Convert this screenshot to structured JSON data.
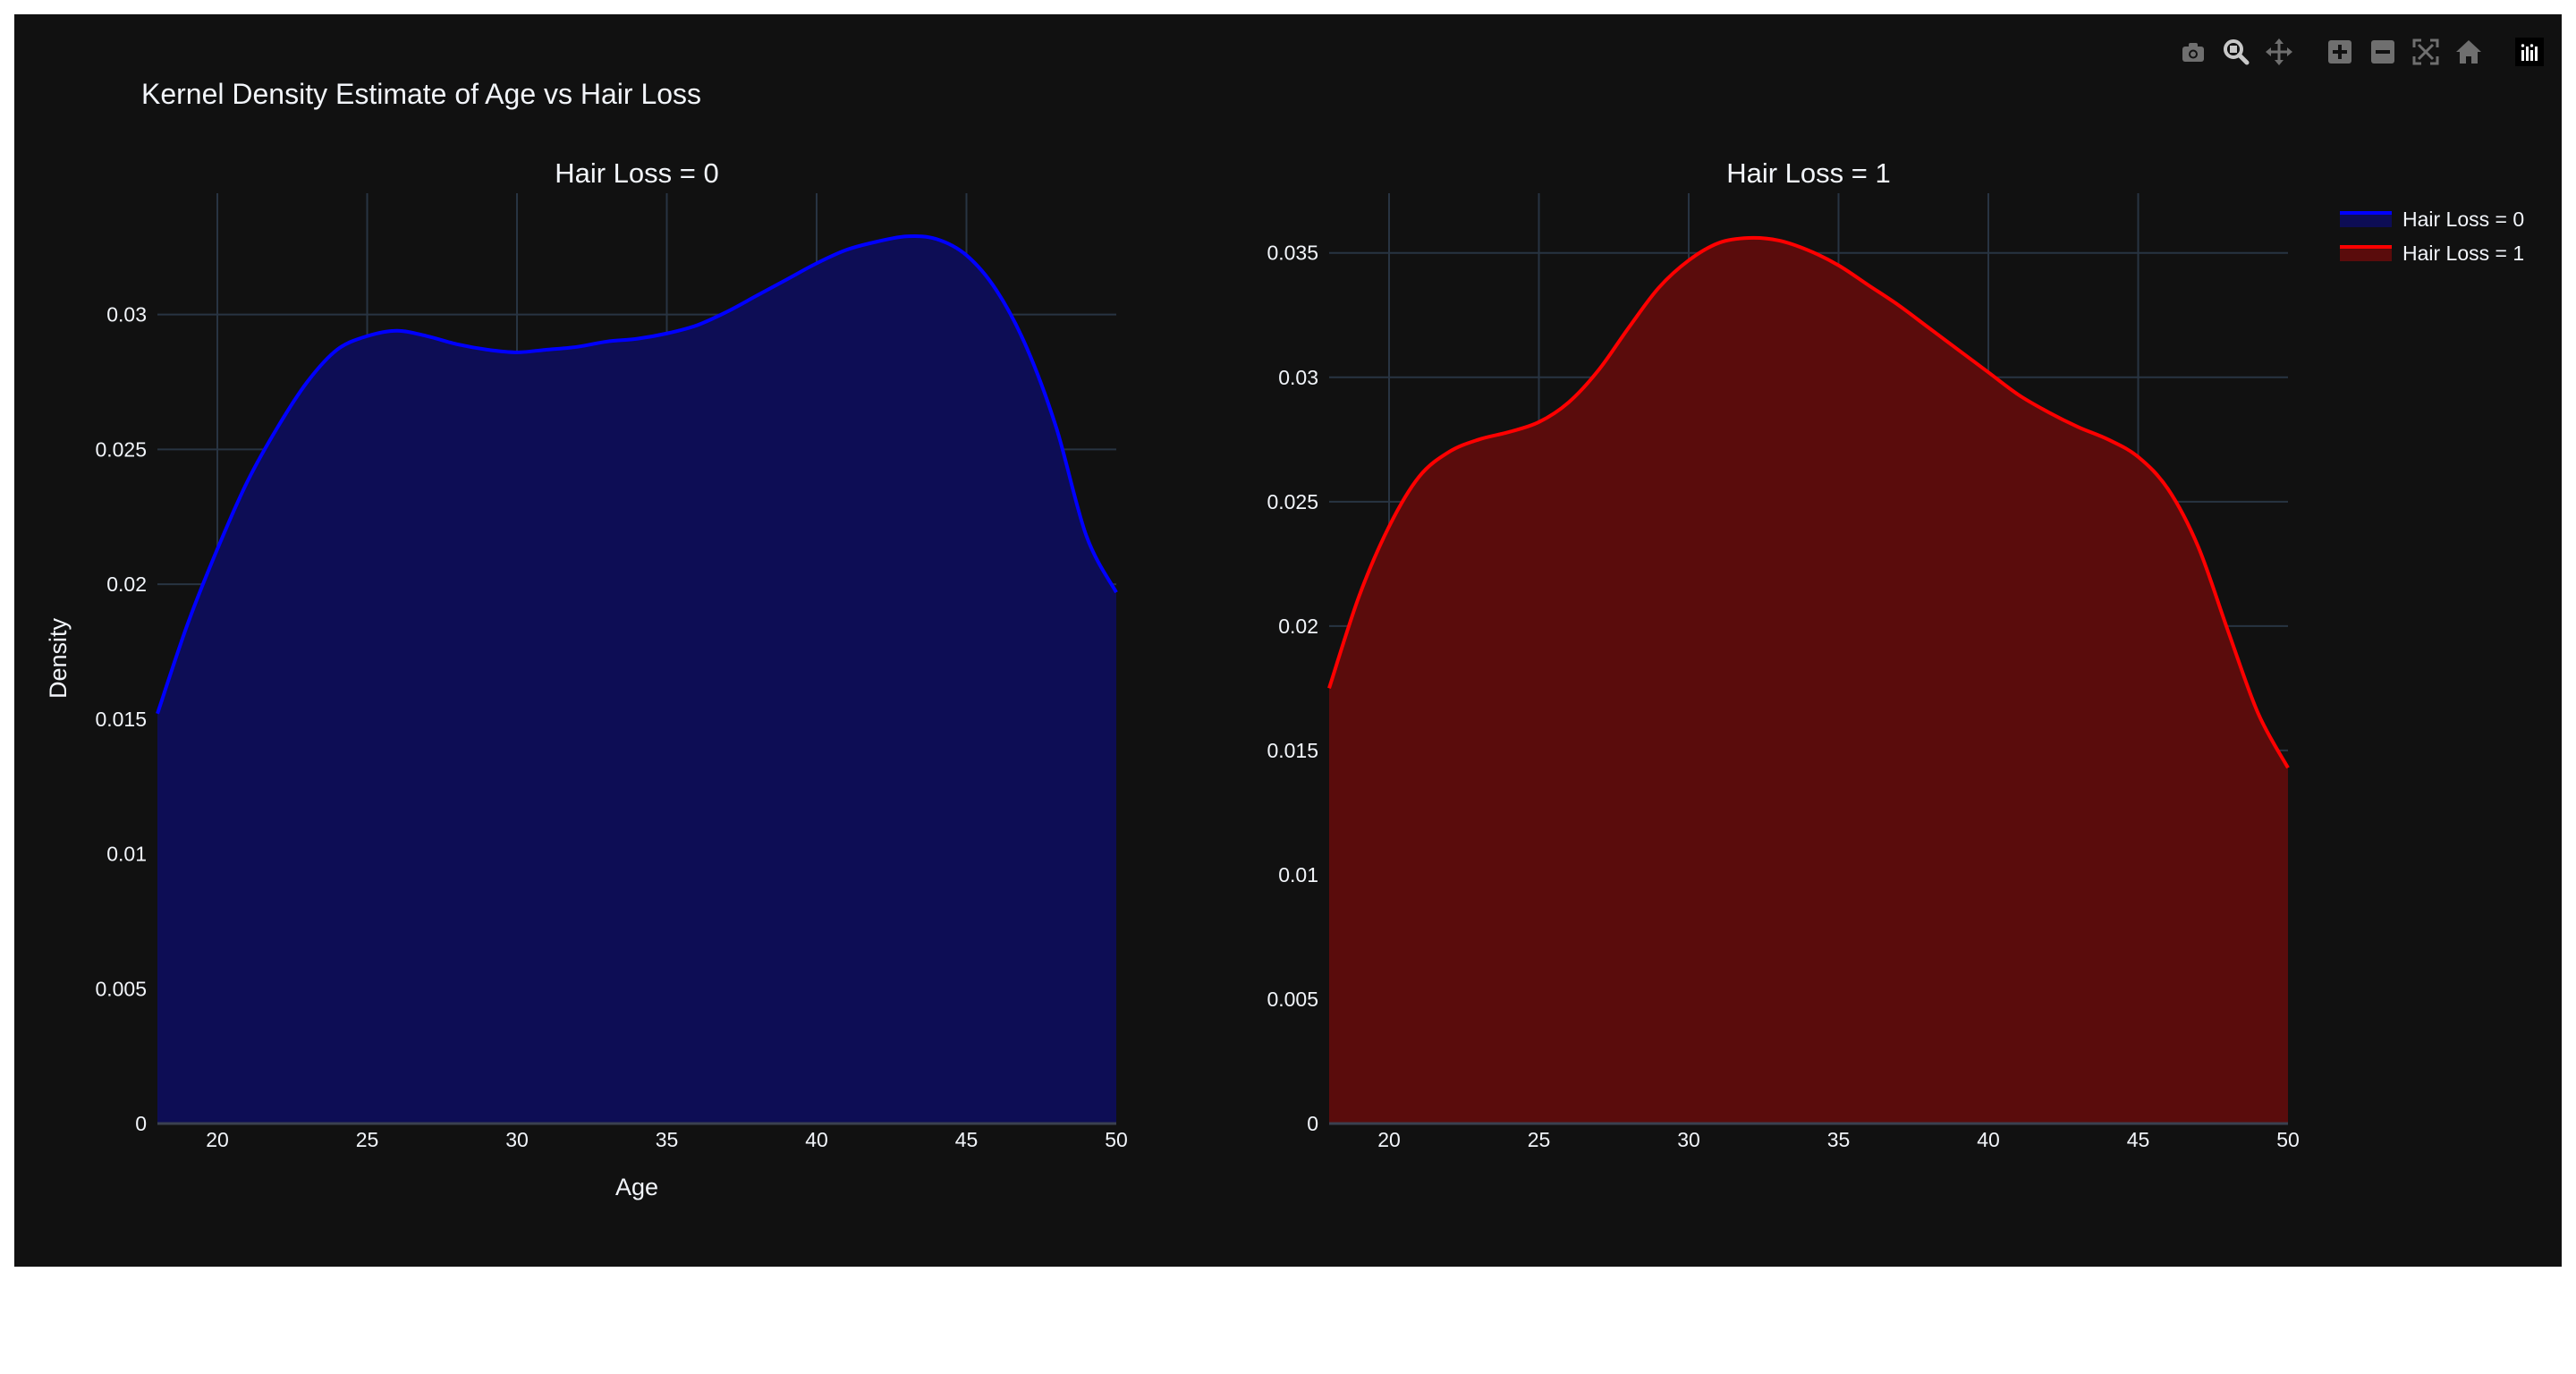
{
  "figure": {
    "title": "Kernel Density Estimate of Age vs Hair Loss",
    "background": "#111111",
    "grid_color": "#283442",
    "text_color": "#f2f5fa"
  },
  "modebar": {
    "icons": [
      "camera-icon",
      "zoom-icon",
      "pan-icon",
      "zoom-in-icon",
      "zoom-out-icon",
      "autoscale-icon",
      "reset-axes-icon",
      "plotly-logo-icon"
    ]
  },
  "legend": {
    "items": [
      {
        "label": "Hair Loss = 0",
        "color": "#0000ff",
        "fill": "#0d0d55"
      },
      {
        "label": "Hair Loss = 1",
        "color": "#ff0000",
        "fill": "#5a0c0c"
      }
    ]
  },
  "chart_data": [
    {
      "type": "area",
      "title": "Hair Loss = 0",
      "xlabel": "Age",
      "ylabel": "Density",
      "xlim": [
        18,
        50
      ],
      "ylim": [
        0,
        0.0345
      ],
      "xticks": [
        20,
        25,
        30,
        35,
        40,
        45,
        50
      ],
      "yticks": [
        0,
        0.005,
        0.01,
        0.015,
        0.02,
        0.025,
        0.03
      ],
      "ytick_labels": [
        "0",
        "0.005",
        "0.01",
        "0.015",
        "0.02",
        "0.025",
        "0.03"
      ],
      "grid": true,
      "series": [
        {
          "name": "Hair Loss = 0",
          "color": "#0000ff",
          "fill": "#0d0d55",
          "x": [
            18,
            19,
            20,
            21,
            22,
            23,
            24,
            25,
            26,
            27,
            28,
            29,
            30,
            31,
            32,
            33,
            34,
            35,
            36,
            37,
            38,
            39,
            40,
            41,
            42,
            43,
            44,
            45,
            46,
            47,
            48,
            49,
            50
          ],
          "y": [
            0.0152,
            0.0185,
            0.0213,
            0.0238,
            0.0258,
            0.0275,
            0.0287,
            0.0292,
            0.0294,
            0.0292,
            0.0289,
            0.0287,
            0.0286,
            0.0287,
            0.0288,
            0.029,
            0.0291,
            0.0293,
            0.0296,
            0.0301,
            0.0307,
            0.0313,
            0.0319,
            0.0324,
            0.0327,
            0.0329,
            0.0328,
            0.0322,
            0.0309,
            0.0288,
            0.0258,
            0.0218,
            0.0197
          ]
        }
      ]
    },
    {
      "type": "area",
      "title": "Hair Loss = 1",
      "xlabel": "",
      "ylabel": "",
      "xlim": [
        18,
        50
      ],
      "ylim": [
        0,
        0.0374
      ],
      "xticks": [
        20,
        25,
        30,
        35,
        40,
        45,
        50
      ],
      "yticks": [
        0,
        0.005,
        0.01,
        0.015,
        0.02,
        0.025,
        0.03,
        0.035
      ],
      "ytick_labels": [
        "0",
        "0.005",
        "0.01",
        "0.015",
        "0.02",
        "0.025",
        "0.03",
        "0.035"
      ],
      "grid": true,
      "series": [
        {
          "name": "Hair Loss = 1",
          "color": "#ff0000",
          "fill": "#5a0c0c",
          "x": [
            18,
            19,
            20,
            21,
            22,
            23,
            24,
            25,
            26,
            27,
            28,
            29,
            30,
            31,
            32,
            33,
            34,
            35,
            36,
            37,
            38,
            39,
            40,
            41,
            42,
            43,
            44,
            45,
            46,
            47,
            48,
            49,
            50
          ],
          "y": [
            0.0175,
            0.0212,
            0.024,
            0.026,
            0.027,
            0.0275,
            0.0278,
            0.0282,
            0.029,
            0.0303,
            0.032,
            0.0336,
            0.0347,
            0.0354,
            0.0356,
            0.0355,
            0.0351,
            0.0345,
            0.0337,
            0.0329,
            0.032,
            0.0311,
            0.0302,
            0.0293,
            0.0286,
            0.028,
            0.0275,
            0.0268,
            0.0255,
            0.0232,
            0.0198,
            0.0165,
            0.0143
          ]
        }
      ]
    }
  ]
}
